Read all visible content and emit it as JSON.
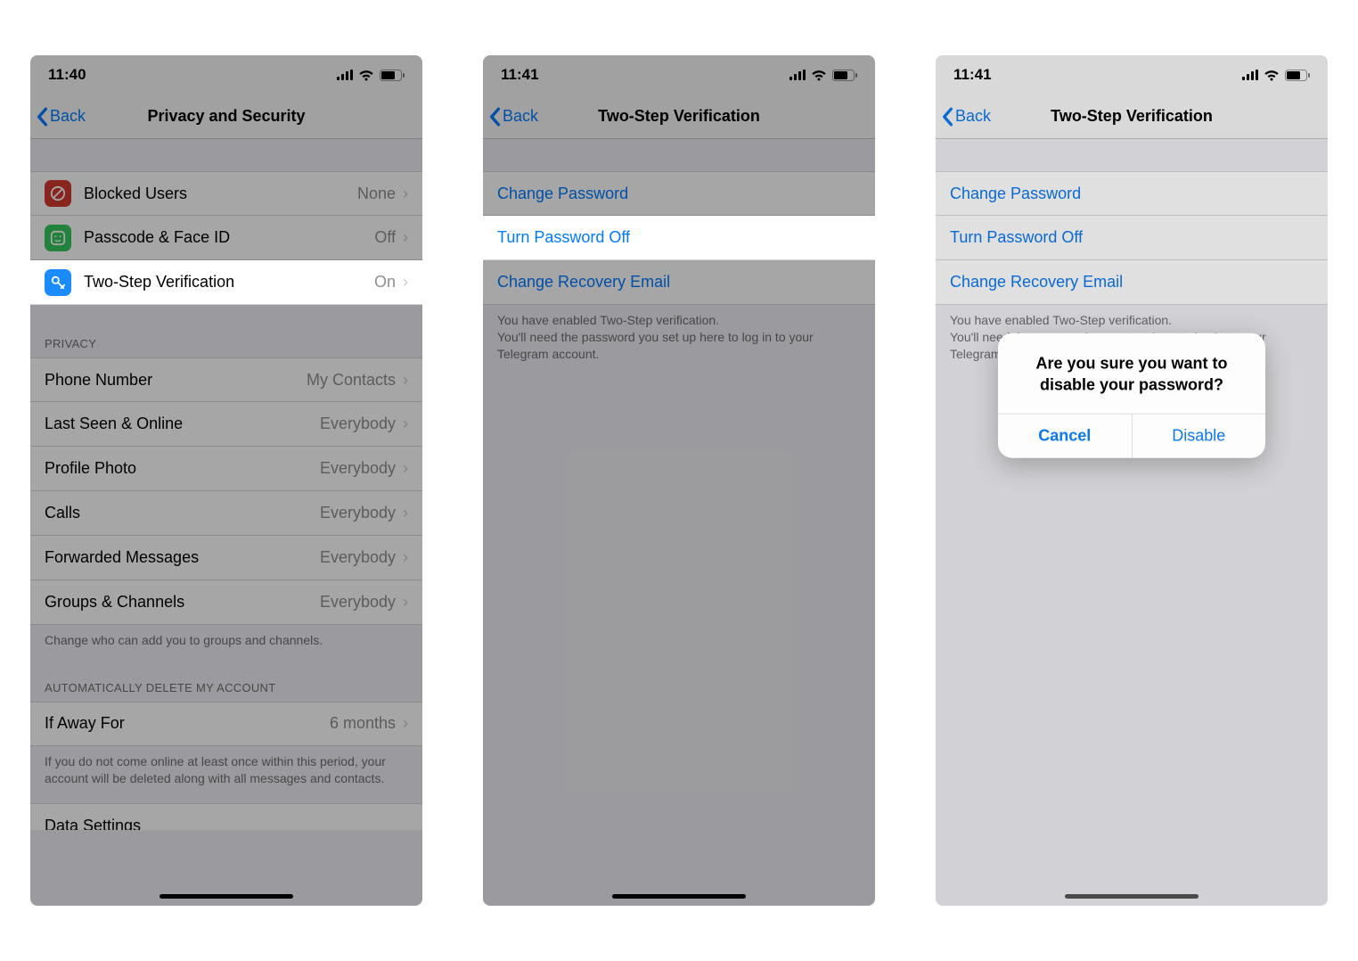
{
  "screen1": {
    "time": "11:40",
    "back": "Back",
    "title": "Privacy and Security",
    "security_cells": [
      {
        "label": "Blocked Users",
        "value": "None",
        "icon_bg": "#d33a30",
        "icon": "ban"
      },
      {
        "label": "Passcode & Face ID",
        "value": "Off",
        "icon_bg": "#35c759",
        "icon": "faceid"
      },
      {
        "label": "Two-Step Verification",
        "value": "On",
        "icon_bg": "#1a8cff",
        "icon": "key",
        "highlight": true
      }
    ],
    "privacy_header": "Privacy",
    "privacy_cells": [
      {
        "label": "Phone Number",
        "value": "My Contacts"
      },
      {
        "label": "Last Seen & Online",
        "value": "Everybody"
      },
      {
        "label": "Profile Photo",
        "value": "Everybody"
      },
      {
        "label": "Calls",
        "value": "Everybody"
      },
      {
        "label": "Forwarded Messages",
        "value": "Everybody"
      },
      {
        "label": "Groups & Channels",
        "value": "Everybody"
      }
    ],
    "privacy_footer": "Change who can add you to groups and channels.",
    "delete_header": "Automatically Delete My Account",
    "delete_cell": {
      "label": "If Away For",
      "value": "6 months"
    },
    "delete_footer": "If you do not come online at least once within this period, your account will be deleted along with all messages and contacts.",
    "partial_next": "Data Settings"
  },
  "screen2": {
    "time": "11:41",
    "back": "Back",
    "title": "Two-Step Verification",
    "cells": [
      {
        "label": "Change Password"
      },
      {
        "label": "Turn Password Off",
        "highlight": true
      },
      {
        "label": "Change Recovery Email"
      }
    ],
    "footer": "You have enabled Two-Step verification.\nYou'll need the password you set up here to log in to your Telegram account."
  },
  "screen3": {
    "time": "11:41",
    "back": "Back",
    "title": "Two-Step Verification",
    "cells": [
      {
        "label": "Change Password"
      },
      {
        "label": "Turn Password Off"
      },
      {
        "label": "Change Recovery Email"
      }
    ],
    "footer": "You have enabled Two-Step verification.\nYou'll need the password you set up here to log in to your Telegram account.",
    "popup": {
      "message": "Are you sure you want to disable your password?",
      "cancel": "Cancel",
      "confirm": "Disable"
    }
  }
}
